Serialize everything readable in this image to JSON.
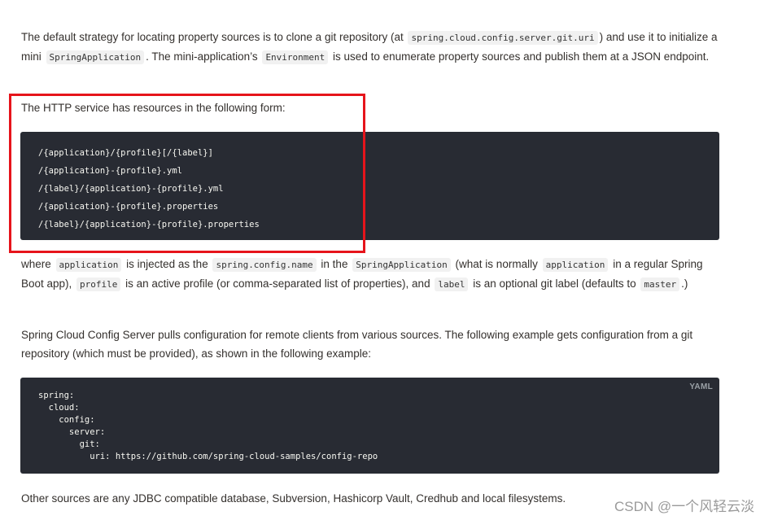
{
  "paragraphs": {
    "p1": {
      "t1": "The default strategy for locating property sources is to clone a git repository (at ",
      "c1": "spring.cloud.config.server.git.uri",
      "t2": ") and use it to initialize a mini ",
      "c2": "SpringApplication",
      "t3": ". The mini-application’s ",
      "c3": "Environment",
      "t4": " is used to enumerate property sources and publish them at a JSON endpoint."
    },
    "p2": {
      "text": "The HTTP service has resources in the following form:"
    },
    "p3": {
      "t1": "where ",
      "c1": "application",
      "t2": " is injected as the ",
      "c2": "spring.config.name",
      "t3": " in the ",
      "c3": "SpringApplication",
      "t4": " (what is normally ",
      "c4": "application",
      "t5": " in a regular Spring Boot app), ",
      "c5": "profile",
      "t6": " is an active profile (or comma-separated list of properties), and ",
      "c6": "label",
      "t7": " is an optional git label (defaults to ",
      "c7": "master",
      "t8": ".)"
    },
    "p4": {
      "text": "Spring Cloud Config Server pulls configuration for remote clients from various sources. The following example gets configuration from a git repository (which must be provided), as shown in the following example:"
    },
    "p5": {
      "text": "Other sources are any JDBC compatible database, Subversion, Hashicorp Vault, Credhub and local filesystems."
    }
  },
  "code_blocks": [
    {
      "language": "",
      "lines": [
        "/{application}/{profile}[/{label}]",
        "/{application}-{profile}.yml",
        "/{label}/{application}-{profile}.yml",
        "/{application}-{profile}.properties",
        "/{label}/{application}-{profile}.properties"
      ]
    },
    {
      "language": "YAML",
      "lines": [
        "spring:",
        "  cloud:",
        "    config:",
        "      server:",
        "        git:",
        "          uri: https://github.com/spring-cloud-samples/config-repo"
      ]
    }
  ],
  "annotation": {
    "color": "#e6141b"
  },
  "watermark": "CSDN @一个风轻云淡"
}
